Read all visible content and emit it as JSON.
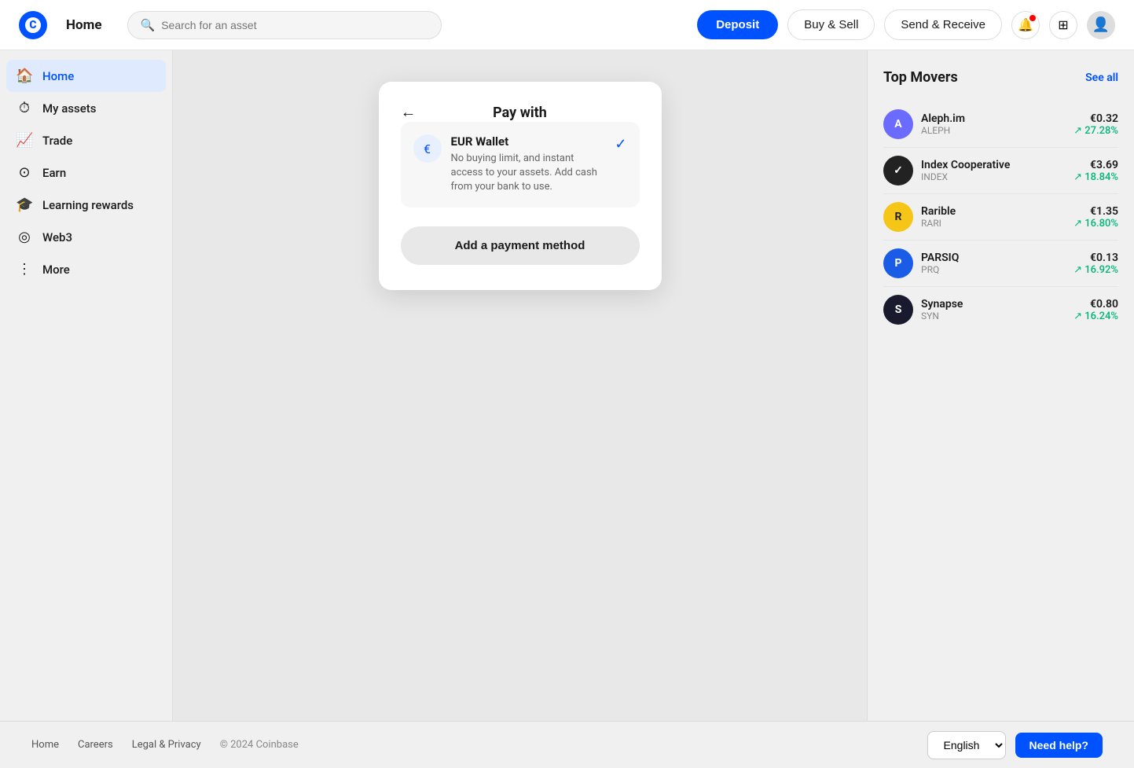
{
  "topbar": {
    "home_label": "Home",
    "search_placeholder": "Search for an asset",
    "deposit_label": "Deposit",
    "buy_sell_label": "Buy & Sell",
    "send_receive_label": "Send & Receive"
  },
  "sidebar": {
    "items": [
      {
        "id": "home",
        "label": "Home",
        "icon": "🏠",
        "active": true
      },
      {
        "id": "my-assets",
        "label": "My assets",
        "icon": "⏱"
      },
      {
        "id": "trade",
        "label": "Trade",
        "icon": "📈"
      },
      {
        "id": "earn",
        "label": "Earn",
        "icon": "%"
      },
      {
        "id": "learning-rewards",
        "label": "Learning rewards",
        "icon": "🎓"
      },
      {
        "id": "web3",
        "label": "Web3",
        "icon": "◎"
      },
      {
        "id": "more",
        "label": "More",
        "icon": "⋮"
      }
    ]
  },
  "modal": {
    "title": "Pay with",
    "wallet": {
      "name": "EUR Wallet",
      "description": "No buying limit, and instant access to your assets. Add cash from your bank to use."
    },
    "add_payment_label": "Add a payment method"
  },
  "top_movers": {
    "title": "Top Movers",
    "see_all_label": "See all",
    "items": [
      {
        "name": "Aleph.im",
        "ticker": "ALEPH",
        "price": "€0.32",
        "change": "↗ 27.28%",
        "bg": "#6b6bff",
        "color": "white",
        "initials": "A"
      },
      {
        "name": "Index Cooperative",
        "ticker": "INDEX",
        "price": "€3.69",
        "change": "↗ 18.84%",
        "bg": "#222",
        "color": "white",
        "initials": "✓"
      },
      {
        "name": "Rarible",
        "ticker": "RARI",
        "price": "€1.35",
        "change": "↗ 16.80%",
        "bg": "#f5c518",
        "color": "#222",
        "initials": "R"
      },
      {
        "name": "PARSIQ",
        "ticker": "PRQ",
        "price": "€0.13",
        "change": "↗ 16.92%",
        "bg": "#1a5ce6",
        "color": "white",
        "initials": "P"
      },
      {
        "name": "Synapse",
        "ticker": "SYN",
        "price": "€0.80",
        "change": "↗ 16.24%",
        "bg": "#1a1a2e",
        "color": "white",
        "initials": "S"
      }
    ]
  },
  "footer": {
    "links": [
      {
        "label": "Home"
      },
      {
        "label": "Careers"
      },
      {
        "label": "Legal & Privacy"
      }
    ],
    "copyright": "© 2024 Coinbase",
    "language": "English",
    "help_label": "Need help?"
  }
}
